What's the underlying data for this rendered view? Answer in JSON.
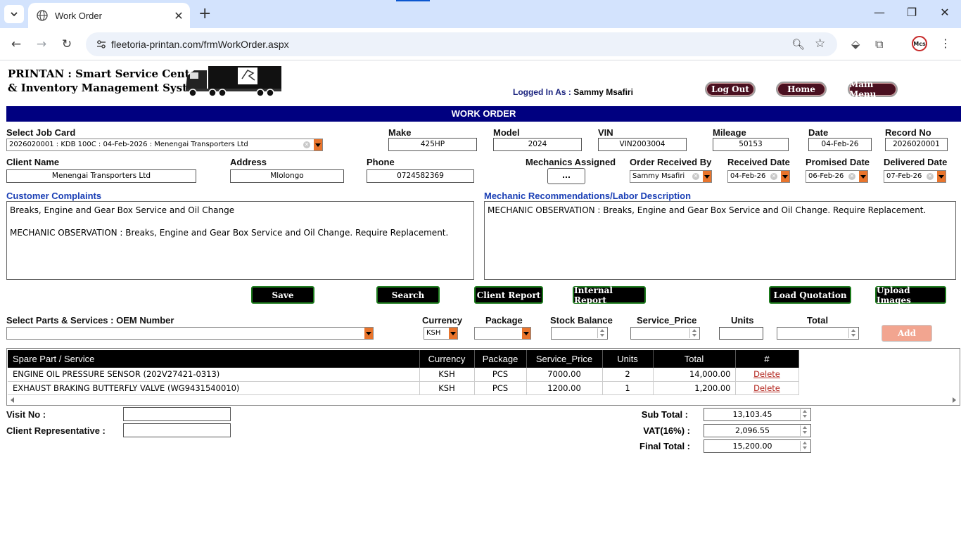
{
  "browser": {
    "tab_title": "Work Order",
    "url": "fleetoria-printan.com/frmWorkOrder.aspx",
    "profile_label": "Mcs"
  },
  "header": {
    "app_name_line1": "PRINTAN : Smart Service Center",
    "app_name_line2": "& Inventory Management System",
    "logged_in_label": "Logged In As :",
    "logged_in_user": "Sammy Msafiri",
    "logout_label": "Log Out",
    "home_label": "Home",
    "main_menu_label": "Main Menu"
  },
  "page_title": "WORK ORDER",
  "job": {
    "job_card_label": "Select Job Card",
    "job_card_value": "2026020001 : KDB 100C : 04-Feb-2026 : Menengai Transporters Ltd",
    "make_label": "Make",
    "make_value": "425HP",
    "model_label": "Model",
    "model_value": "2024",
    "vin_label": "VIN",
    "vin_value": "VIN2003004",
    "mileage_label": "Mileage",
    "mileage_value": "50153",
    "date_label": "Date",
    "date_value": "04-Feb-26",
    "record_label": "Record No",
    "record_value": "2026020001"
  },
  "client": {
    "name_label": "Client Name",
    "name_value": "Menengai Transporters Ltd",
    "address_label": "Address",
    "address_value": "Mlolongo",
    "phone_label": "Phone",
    "phone_value": "0724582369",
    "mechanics_label": "Mechanics Assigned",
    "mechanics_button": "...",
    "received_by_label": "Order Received By",
    "received_by_value": "Sammy Msafiri",
    "received_date_label": "Received Date",
    "received_date_value": "04-Feb-26",
    "promised_date_label": "Promised Date",
    "promised_date_value": "06-Feb-26",
    "delivered_date_label": "Delivered Date",
    "delivered_date_value": "07-Feb-26"
  },
  "notes": {
    "complaints_label": "Customer Complaints",
    "complaints_text": "Breaks, Engine and Gear Box Service and Oil Change\n\nMECHANIC OBSERVATION : Breaks, Engine and Gear Box Service and Oil Change. Require Replacement.",
    "recommendations_label": "Mechanic Recommendations/Labor Description",
    "recommendations_text": "MECHANIC OBSERVATION : Breaks, Engine and Gear Box Service and Oil Change. Require Replacement."
  },
  "actions": {
    "save": "Save",
    "search": "Search",
    "client_report": "Client Report",
    "internal_report": "Internal Report",
    "load_quotation": "Load Quotation",
    "upload_images": "Upload Images"
  },
  "parts_form": {
    "parts_label": "Select Parts & Services : OEM Number",
    "currency_label": "Currency",
    "currency_value": "KSH",
    "package_label": "Package",
    "stock_label": "Stock Balance",
    "price_label": "Service_Price",
    "units_label": "Units",
    "total_label": "Total",
    "add_label": "Add"
  },
  "grid": {
    "columns": [
      "Spare Part / Service",
      "Currency",
      "Package",
      "Service_Price",
      "Units",
      "Total",
      "#"
    ],
    "rows": [
      {
        "part": "ENGINE OIL PRESSURE SENSOR (202V27421-0313)",
        "currency": "KSH",
        "package": "PCS",
        "price": "7000.00",
        "units": "2",
        "total": "14,000.00",
        "action": "Delete"
      },
      {
        "part": "EXHAUST BRAKING BUTTERFLY VALVE (WG9431540010)",
        "currency": "KSH",
        "package": "PCS",
        "price": "1200.00",
        "units": "1",
        "total": "1,200.00",
        "action": "Delete"
      }
    ]
  },
  "footer": {
    "visit_label": "Visit No :",
    "rep_label": "Client Representative :",
    "subtotal_label": "Sub Total :",
    "subtotal_value": "13,103.45",
    "vat_label": "VAT(16%) :",
    "vat_value": "2,096.55",
    "final_label": "Final Total :",
    "final_value": "15,200.00"
  }
}
